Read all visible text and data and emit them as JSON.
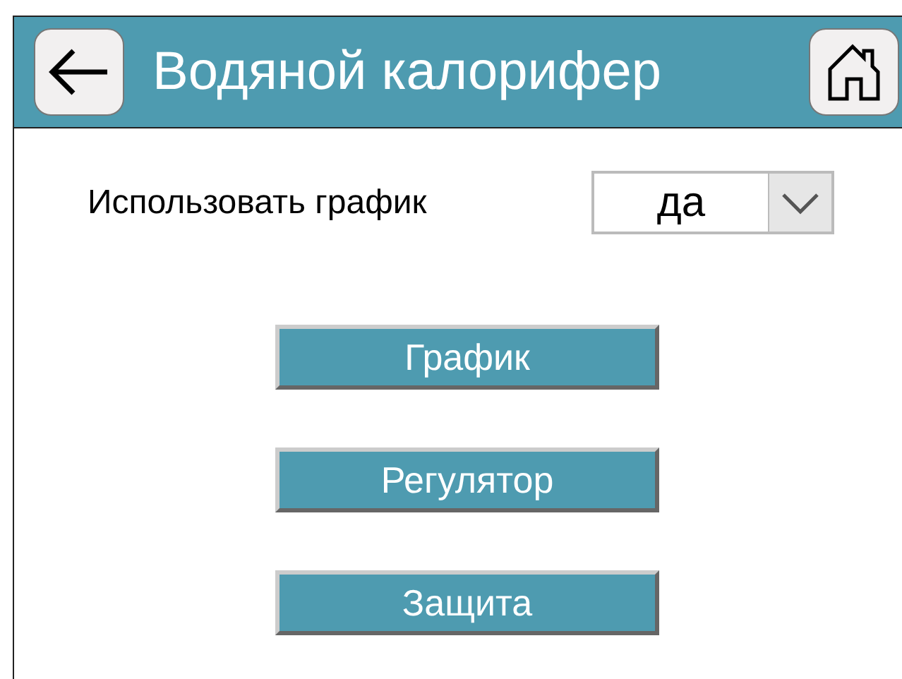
{
  "header": {
    "title": "Водяной калорифер"
  },
  "schedule_setting": {
    "label": "Использовать график",
    "value": "да"
  },
  "buttons": [
    "График",
    "Регулятор",
    "Защита"
  ]
}
